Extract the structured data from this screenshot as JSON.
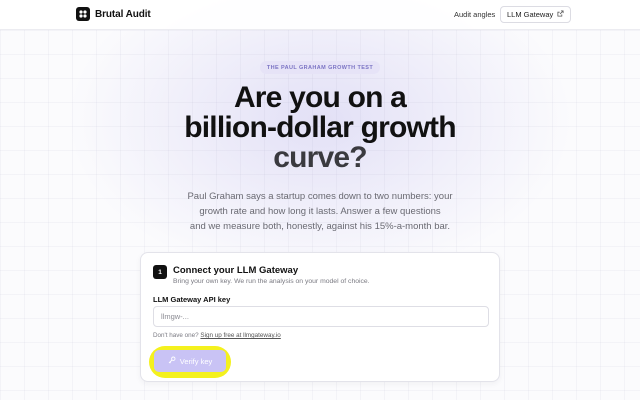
{
  "header": {
    "brand": "Brutal Audit",
    "nav_link": "Audit angles",
    "nav_button": "LLM Gateway"
  },
  "hero": {
    "eyebrow": "THE PAUL GRAHAM GROWTH TEST",
    "headline_line1": "Are you on a",
    "headline_line2": "billion-dollar growth",
    "headline_line3": "curve?",
    "sub_line1": "Paul Graham says a startup comes down to two numbers: your",
    "sub_line2": "growth rate and how long it lasts. Answer a few questions",
    "sub_line3": "and we measure both, honestly, against his 15%-a-month bar."
  },
  "card": {
    "step": "1",
    "title": "Connect your LLM Gateway",
    "description": "Bring your own key. We run the analysis on your model of choice.",
    "field_label": "LLM Gateway API key",
    "input_value": "",
    "input_placeholder": "llmgw-...",
    "hint_prefix": "Don't have one?",
    "hint_link": "Sign up free at llmgateway.io",
    "verify_label": "Verify key"
  },
  "colors": {
    "accent": "#c9c3f5",
    "highlight": "#f4f11e",
    "eyebrow_text": "#7b74c4"
  },
  "icons": {
    "brand": "logo-icon",
    "external": "external-link-icon",
    "key": "key-icon"
  }
}
